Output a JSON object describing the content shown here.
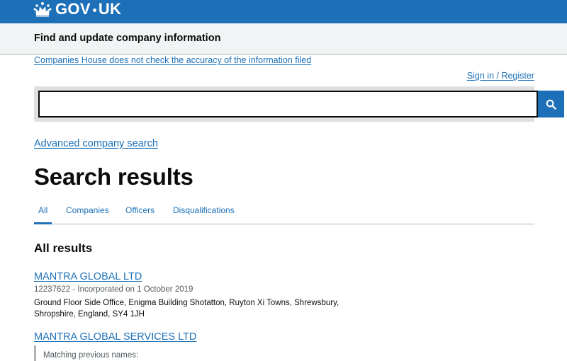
{
  "header": {
    "logo_text_left": "GOV",
    "logo_text_right": "UK"
  },
  "service": {
    "name": "Find and update company information"
  },
  "notice": {
    "text": "Companies House does not check the accuracy of the information filed"
  },
  "account": {
    "sign_in_label": "Sign in / Register"
  },
  "search": {
    "value": "",
    "button_icon": "search-icon"
  },
  "advanced_search": {
    "label": "Advanced company search"
  },
  "page": {
    "title": "Search results"
  },
  "tabs": [
    {
      "label": "All",
      "selected": true
    },
    {
      "label": "Companies",
      "selected": false
    },
    {
      "label": "Officers",
      "selected": false
    },
    {
      "label": "Disqualifications",
      "selected": false
    }
  ],
  "results": {
    "heading": "All results",
    "items": [
      {
        "title": "MANTRA GLOBAL LTD",
        "meta": "12237622 - Incorporated on 1 October 2019",
        "address": "Ground Floor Side Office, Enigma Building Shotatton, Ruyton Xi Towns, Shrewsbury, Shropshire, England, SY4 1JH"
      },
      {
        "title": "MANTRA GLOBAL SERVICES LTD",
        "previous_names_label": "Matching previous names:"
      }
    ]
  },
  "colors": {
    "brand_blue": "#1d70b8",
    "service_bar": "#f0f4f5",
    "search_bg": "#dee0e2"
  }
}
